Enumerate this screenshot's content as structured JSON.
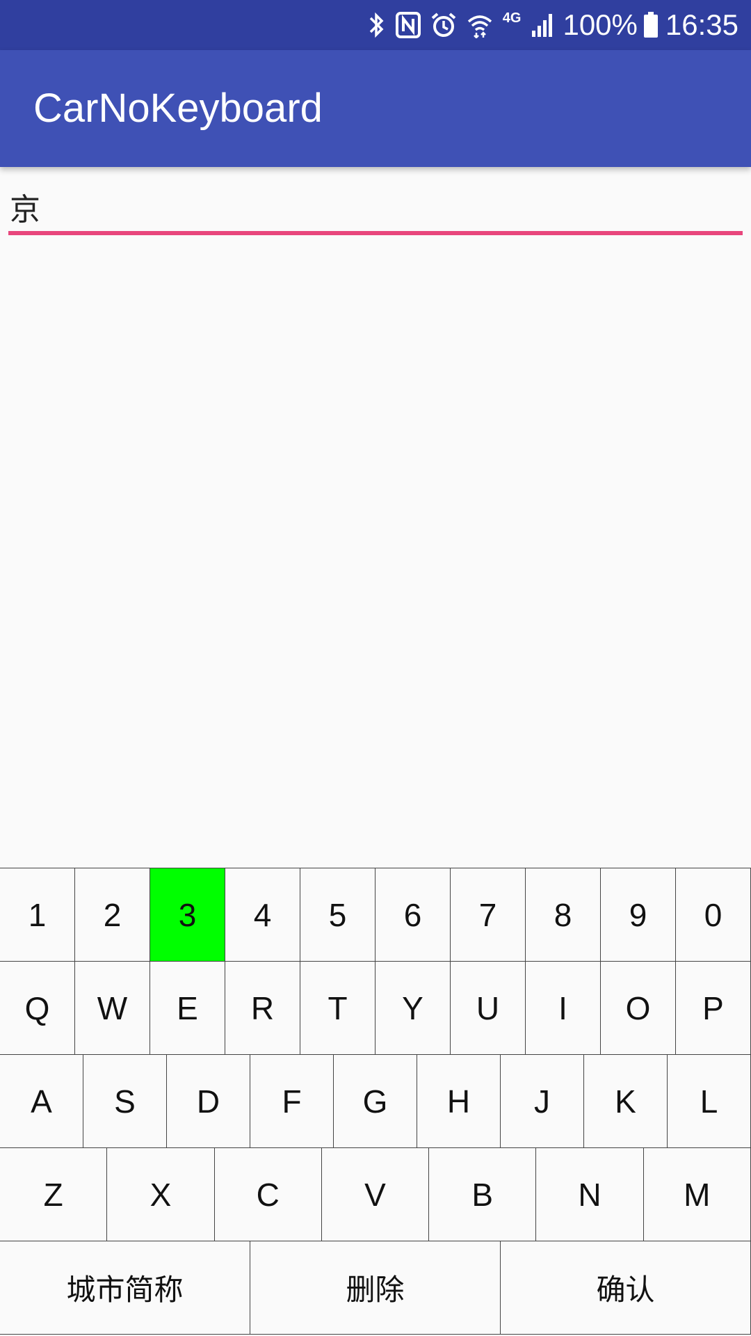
{
  "status_bar": {
    "icons": [
      "bluetooth-icon",
      "nfc-icon",
      "alarm-icon",
      "wifi-icon",
      "signal-icon",
      "battery-icon"
    ],
    "network": "4G",
    "battery": "100%",
    "time": "16:35"
  },
  "app_bar": {
    "title": "CarNoKeyboard",
    "color": "#3f51b5",
    "status_color": "#303f9f"
  },
  "plate_input": {
    "value": "京",
    "underline_color": "#e8467c"
  },
  "keyboard": {
    "active_key": "3",
    "active_color": "#00ff00",
    "rows": [
      [
        "1",
        "2",
        "3",
        "4",
        "5",
        "6",
        "7",
        "8",
        "9",
        "0"
      ],
      [
        "Q",
        "W",
        "E",
        "R",
        "T",
        "Y",
        "U",
        "I",
        "O",
        "P"
      ],
      [
        "A",
        "S",
        "D",
        "F",
        "G",
        "H",
        "J",
        "K",
        "L"
      ],
      [
        "Z",
        "X",
        "C",
        "V",
        "B",
        "N",
        "M"
      ],
      [
        "城市简称",
        "删除",
        "确认"
      ]
    ]
  }
}
